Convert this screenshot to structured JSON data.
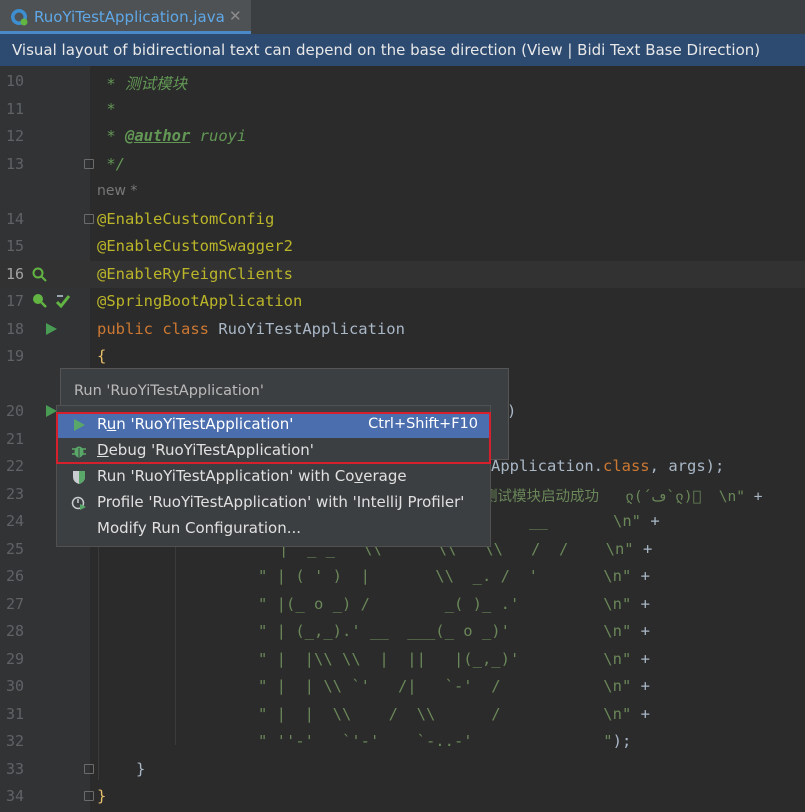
{
  "tab": {
    "filename": "RuoYiTestApplication.java",
    "close": "✕"
  },
  "banner": {
    "text": "Visual layout of bidirectional text can depend on the base direction (View | Bidi Text Base Direction)"
  },
  "editor": {
    "hint_new": "new *",
    "lines": {
      "l10": {
        "num": "10",
        "c1": " * 测试模块"
      },
      "l11": {
        "num": "11",
        "c1": " *"
      },
      "l12": {
        "num": "12",
        "c1": " * ",
        "tag": "@author",
        "c2": " ruoyi"
      },
      "l13": {
        "num": "13",
        "c1": " */"
      },
      "l14": {
        "num": "14",
        "c1": "@EnableCustomConfig"
      },
      "l15": {
        "num": "15",
        "c1": "@EnableCustomSwagger2"
      },
      "l16": {
        "num": "16",
        "c1": "@EnableRyFeignClients"
      },
      "l17": {
        "num": "17",
        "c1": "@SpringBootApplication"
      },
      "l18": {
        "num": "18",
        "kw": "public class ",
        "c1": "RuoYiTestApplication"
      },
      "l19": {
        "num": "19",
        "c1": "{"
      },
      "l20": {
        "num": "20",
        "c1": ")"
      },
      "l21": {
        "num": "21",
        "c1": ")"
      },
      "l22": {
        "num": "22",
        "c1": "Application.",
        "kw": "class",
        "c2": ", args);"
      },
      "l23": {
        "num": "23",
        "s1": "测试模块启动成功   ლ(´ڡ`ლ)゙  \\n\"",
        "c2": " +"
      },
      "l24": {
        "num": "24",
        "s1": "__       \\n\"",
        "c2": " +"
      },
      "l25": {
        "num": "25",
        "s1": "|  _ _   \\\\      \\\\   \\\\   /  /    \\n\"",
        "c2": " +"
      },
      "l26": {
        "num": "26",
        "s1": "\" | ( ' )  |       \\\\  _. /  '       \\n\"",
        "c2": " +"
      },
      "l27": {
        "num": "27",
        "s1": "\" |(_ o _) /        _( )_ .'         \\n\"",
        "c2": " +"
      },
      "l28": {
        "num": "28",
        "s1": "\" | (_,_).' __  ___(_ o _)'          \\n\"",
        "c2": " +"
      },
      "l29": {
        "num": "29",
        "s1": "\" |  |\\\\ \\\\  |  ||   |(_,_)'         \\n\"",
        "c2": " +"
      },
      "l30": {
        "num": "30",
        "s1": "\" |  | \\\\ `'   /|   `-'  /           \\n\"",
        "c2": " +"
      },
      "l31": {
        "num": "31",
        "s1": "\" |  |  \\\\    /  \\\\      /           \\n\"",
        "c2": " +"
      },
      "l32": {
        "num": "32",
        "s1": "\" ''-'   `'-'    `-..-'              \"",
        "c2": ");"
      },
      "l33": {
        "num": "33",
        "c1": "}"
      },
      "l34": {
        "num": "34",
        "c1": "}"
      }
    }
  },
  "tooltip": {
    "title": "Run 'RuoYiTestApplication'"
  },
  "menu": {
    "run": {
      "label_pre": "R",
      "label_u": "u",
      "label_post": "n 'RuoYiTestApplication'",
      "shortcut": "Ctrl+Shift+F10"
    },
    "debug": {
      "label_u": "D",
      "label_post": "ebug 'RuoYiTestApplication'"
    },
    "coverage": {
      "label_pre": "Run 'RuoYiTestApplication' with Co",
      "label_u": "v",
      "label_post": "erage"
    },
    "profile": {
      "label": "Profile 'RuoYiTestApplication' with 'IntelliJ Profiler'"
    },
    "modify": {
      "label": "Modify Run Configuration..."
    }
  },
  "colors": {
    "accent": "#4b6eaf",
    "highlight_border": "#d6202e",
    "banner_bg": "#2d4a70"
  }
}
